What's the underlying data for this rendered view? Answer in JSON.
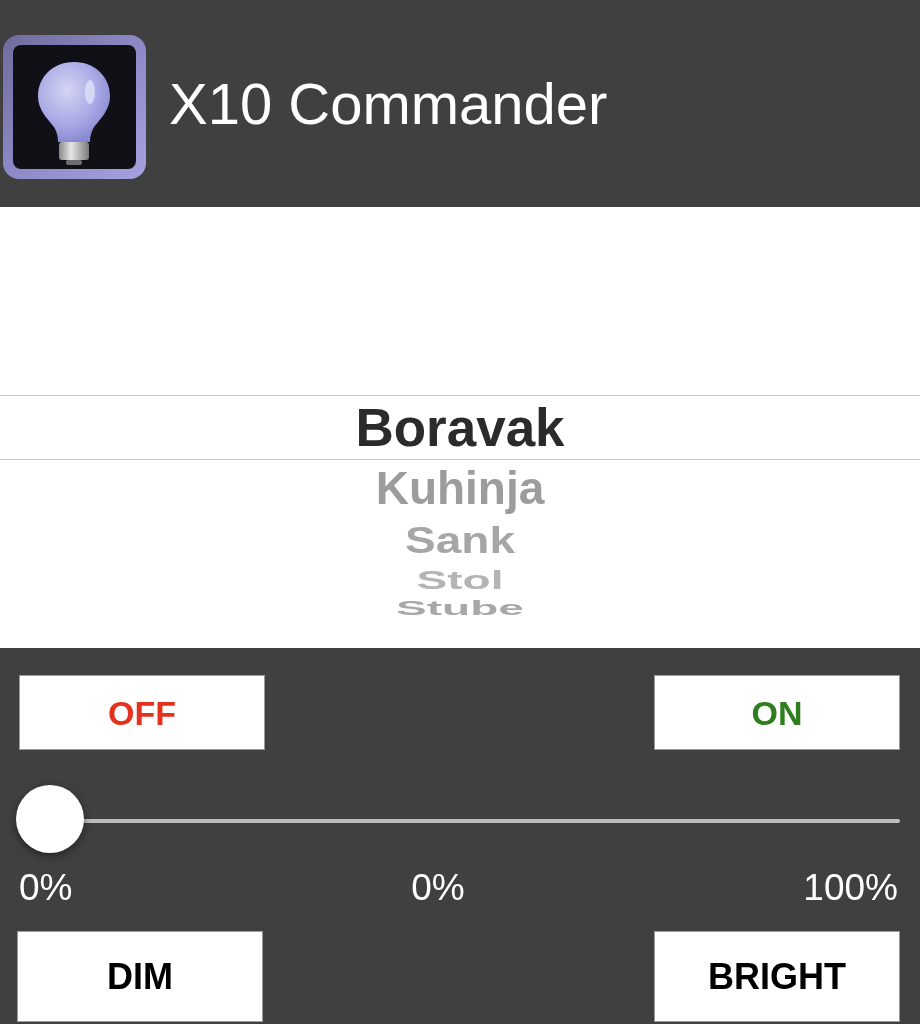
{
  "header": {
    "title": "X10 Commander"
  },
  "picker": {
    "items": [
      {
        "label": "Boravak",
        "selected": true
      },
      {
        "label": "Kuhinja",
        "selected": false
      },
      {
        "label": "Sank",
        "selected": false
      },
      {
        "label": "Stol",
        "selected": false
      },
      {
        "label": "Stube",
        "selected": false
      }
    ]
  },
  "switch_buttons": [
    {
      "label": "OFF",
      "color": "#e5321f"
    },
    {
      "label": "ON",
      "color": "#2e7d1e"
    }
  ],
  "slider": {
    "level": 0,
    "min_label": "0%",
    "value_label": "0%",
    "max_label": "100%"
  },
  "dim_buttons": [
    {
      "label": "DIM"
    },
    {
      "label": "BRIGHT"
    }
  ]
}
